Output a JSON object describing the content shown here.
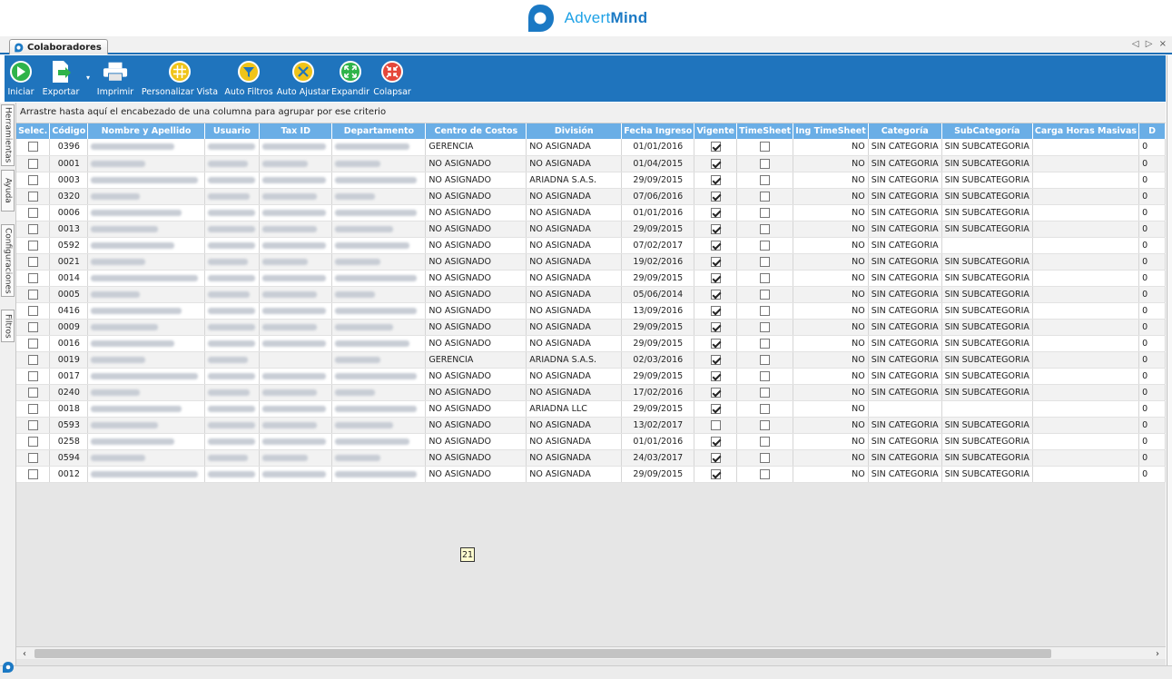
{
  "brand": {
    "name_light": "Advert",
    "name_bold": "Mind",
    "color": "#1da1e6"
  },
  "tab": {
    "title": "Colaboradores",
    "controls": "◁ ▷ ×"
  },
  "toolbar": [
    {
      "id": "iniciar",
      "label": "Iniciar",
      "icon": "play-icon"
    },
    {
      "id": "exportar",
      "label": "Exportar",
      "icon": "export-icon"
    },
    {
      "id": "imprimir",
      "label": "Imprimir",
      "icon": "printer-icon"
    },
    {
      "id": "personalizar",
      "label": "Personalizar Vista",
      "icon": "grid-icon"
    },
    {
      "id": "autofiltros",
      "label": "Auto Filtros",
      "icon": "filter-icon"
    },
    {
      "id": "autoajustar",
      "label": "Auto Ajustar",
      "icon": "adjust-icon"
    },
    {
      "id": "expandir",
      "label": "Expandir",
      "icon": "expand-icon"
    },
    {
      "id": "colapsar",
      "label": "Colapsar",
      "icon": "collapse-icon"
    }
  ],
  "sidetabs": [
    "Herramientas",
    "Ayuda",
    "Configuraciones",
    "Filtros"
  ],
  "grid": {
    "group_hint": "Arrastre hasta aquí el encabezado de una columna para agrupar por ese criterio",
    "columns": [
      "Selec.",
      "Código",
      "Nombre y Apellido",
      "Usuario",
      "Tax ID",
      "Departamento",
      "Centro de Costos",
      "División",
      "Fecha Ingreso",
      "Vigente",
      "TimeSheet",
      "Ing TimeSheet",
      "Categoría",
      "SubCategoría",
      "Carga Horas Masivas",
      "D"
    ],
    "rows": [
      {
        "codigo": "0396",
        "centro": "GERENCIA",
        "division": "NO ASIGNADA",
        "fecha": "01/01/2016",
        "vigente": true,
        "ing": "NO",
        "categoria": "SIN CATEGORIA",
        "subcategoria": "SIN SUBCATEGORIA",
        "d": "0"
      },
      {
        "codigo": "0001",
        "centro": "NO ASIGNADO",
        "division": "NO ASIGNADA",
        "fecha": "01/04/2015",
        "vigente": true,
        "ing": "NO",
        "categoria": "SIN CATEGORIA",
        "subcategoria": "SIN SUBCATEGORIA",
        "d": "0"
      },
      {
        "codigo": "0003",
        "centro": "NO ASIGNADO",
        "division": "ARIADNA S.A.S.",
        "fecha": "29/09/2015",
        "vigente": true,
        "ing": "NO",
        "categoria": "SIN CATEGORIA",
        "subcategoria": "SIN SUBCATEGORIA",
        "d": "0"
      },
      {
        "codigo": "0320",
        "centro": "NO ASIGNADO",
        "division": "NO ASIGNADA",
        "fecha": "07/06/2016",
        "vigente": true,
        "ing": "NO",
        "categoria": "SIN CATEGORIA",
        "subcategoria": "SIN SUBCATEGORIA",
        "d": "0"
      },
      {
        "codigo": "0006",
        "centro": "NO ASIGNADO",
        "division": "NO ASIGNADA",
        "fecha": "01/01/2016",
        "vigente": true,
        "ing": "NO",
        "categoria": "SIN CATEGORIA",
        "subcategoria": "SIN SUBCATEGORIA",
        "d": "0"
      },
      {
        "codigo": "0013",
        "centro": "NO ASIGNADO",
        "division": "NO ASIGNADA",
        "fecha": "29/09/2015",
        "vigente": true,
        "ing": "NO",
        "categoria": "SIN CATEGORIA",
        "subcategoria": "SIN SUBCATEGORIA",
        "d": "0"
      },
      {
        "codigo": "0592",
        "centro": "NO ASIGNADO",
        "division": "NO ASIGNADA",
        "fecha": "07/02/2017",
        "vigente": true,
        "ing": "NO",
        "categoria": "SIN CATEGORIA",
        "subcategoria": "",
        "d": "0"
      },
      {
        "codigo": "0021",
        "centro": "NO ASIGNADO",
        "division": "NO ASIGNADA",
        "fecha": "19/02/2016",
        "vigente": true,
        "ing": "NO",
        "categoria": "SIN CATEGORIA",
        "subcategoria": "SIN SUBCATEGORIA",
        "d": "0"
      },
      {
        "codigo": "0014",
        "centro": "NO ASIGNADO",
        "division": "NO ASIGNADA",
        "fecha": "29/09/2015",
        "vigente": true,
        "ing": "NO",
        "categoria": "SIN CATEGORIA",
        "subcategoria": "SIN SUBCATEGORIA",
        "d": "0"
      },
      {
        "codigo": "0005",
        "centro": "NO ASIGNADO",
        "division": "NO ASIGNADA",
        "fecha": "05/06/2014",
        "vigente": true,
        "ing": "NO",
        "categoria": "SIN CATEGORIA",
        "subcategoria": "SIN SUBCATEGORIA",
        "d": "0"
      },
      {
        "codigo": "0416",
        "centro": "NO ASIGNADO",
        "division": "NO ASIGNADA",
        "fecha": "13/09/2016",
        "vigente": true,
        "ing": "NO",
        "categoria": "SIN CATEGORIA",
        "subcategoria": "SIN SUBCATEGORIA",
        "d": "0"
      },
      {
        "codigo": "0009",
        "centro": "NO ASIGNADO",
        "division": "NO ASIGNADA",
        "fecha": "29/09/2015",
        "vigente": true,
        "ing": "NO",
        "categoria": "SIN CATEGORIA",
        "subcategoria": "SIN SUBCATEGORIA",
        "d": "0"
      },
      {
        "codigo": "0016",
        "centro": "NO ASIGNADO",
        "division": "NO ASIGNADA",
        "fecha": "29/09/2015",
        "vigente": true,
        "ing": "NO",
        "categoria": "SIN CATEGORIA",
        "subcategoria": "SIN SUBCATEGORIA",
        "d": "0"
      },
      {
        "codigo": "0019",
        "centro": "GERENCIA",
        "division": "ARIADNA S.A.S.",
        "fecha": "02/03/2016",
        "vigente": true,
        "ing": "NO",
        "categoria": "SIN CATEGORIA",
        "subcategoria": "SIN SUBCATEGORIA",
        "d": "0"
      },
      {
        "codigo": "0017",
        "centro": "NO ASIGNADO",
        "division": "NO ASIGNADA",
        "fecha": "29/09/2015",
        "vigente": true,
        "ing": "NO",
        "categoria": "SIN CATEGORIA",
        "subcategoria": "SIN SUBCATEGORIA",
        "d": "0"
      },
      {
        "codigo": "0240",
        "centro": "NO ASIGNADO",
        "division": "NO ASIGNADA",
        "fecha": "17/02/2016",
        "vigente": true,
        "ing": "NO",
        "categoria": "SIN CATEGORIA",
        "subcategoria": "SIN SUBCATEGORIA",
        "d": "0"
      },
      {
        "codigo": "0018",
        "centro": "NO ASIGNADO",
        "division": "ARIADNA LLC",
        "fecha": "29/09/2015",
        "vigente": true,
        "ing": "NO",
        "categoria": "",
        "subcategoria": "",
        "d": "0"
      },
      {
        "codigo": "0593",
        "centro": "NO ASIGNADO",
        "division": "NO ASIGNADA",
        "fecha": "13/02/2017",
        "vigente": false,
        "ing": "NO",
        "categoria": "SIN CATEGORIA",
        "subcategoria": "SIN SUBCATEGORIA",
        "d": "0"
      },
      {
        "codigo": "0258",
        "centro": "NO ASIGNADO",
        "division": "NO ASIGNADA",
        "fecha": "01/01/2016",
        "vigente": true,
        "ing": "NO",
        "categoria": "SIN CATEGORIA",
        "subcategoria": "SIN SUBCATEGORIA",
        "d": "0"
      },
      {
        "codigo": "0594",
        "centro": "NO ASIGNADO",
        "division": "NO ASIGNADA",
        "fecha": "24/03/2017",
        "vigente": true,
        "ing": "NO",
        "categoria": "SIN CATEGORIA",
        "subcategoria": "SIN SUBCATEGORIA",
        "d": "0"
      },
      {
        "codigo": "0012",
        "centro": "NO ASIGNADO",
        "division": "NO ASIGNADA",
        "fecha": "29/09/2015",
        "vigente": true,
        "ing": "NO",
        "categoria": "SIN CATEGORIA",
        "subcategoria": "SIN SUBCATEGORIA",
        "d": "0"
      }
    ],
    "record_count": "21"
  },
  "scroll": {
    "left": "‹",
    "right": "›"
  }
}
